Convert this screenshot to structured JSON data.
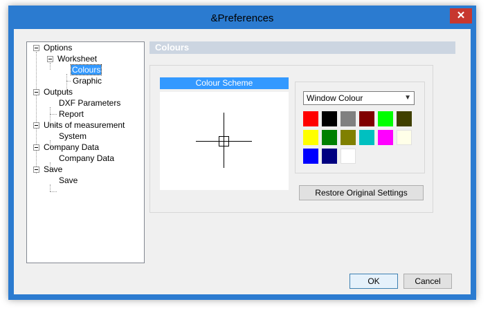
{
  "window": {
    "title": "&Preferences",
    "close_glyph": "✕"
  },
  "tree": {
    "items": [
      {
        "label": "Options"
      },
      {
        "label": "Worksheet"
      },
      {
        "label": "Colours"
      },
      {
        "label": "Graphic"
      },
      {
        "label": "Outputs"
      },
      {
        "label": "DXF Parameters"
      },
      {
        "label": "Report"
      },
      {
        "label": "Units of measurement"
      },
      {
        "label": "System"
      },
      {
        "label": "Company Data"
      },
      {
        "label": "Company Data"
      },
      {
        "label": "Save"
      },
      {
        "label": "Save"
      }
    ],
    "selected": "Colours"
  },
  "section": {
    "title": "Colours"
  },
  "preview": {
    "title": "Colour Scheme"
  },
  "scheme_select": {
    "value": "Window Colour"
  },
  "palette": {
    "colors": [
      "#ff0000",
      "#000000",
      "#808080",
      "#800000",
      "#00ff00",
      "#404000",
      "#ffff00",
      "#008000",
      "#808000",
      "#00c0c0",
      "#ff00ff",
      "#ffffe8",
      "#0000ff",
      "#000080",
      "#ffffff"
    ]
  },
  "buttons": {
    "restore": "Restore Original Settings",
    "ok": "OK",
    "cancel": "Cancel"
  }
}
